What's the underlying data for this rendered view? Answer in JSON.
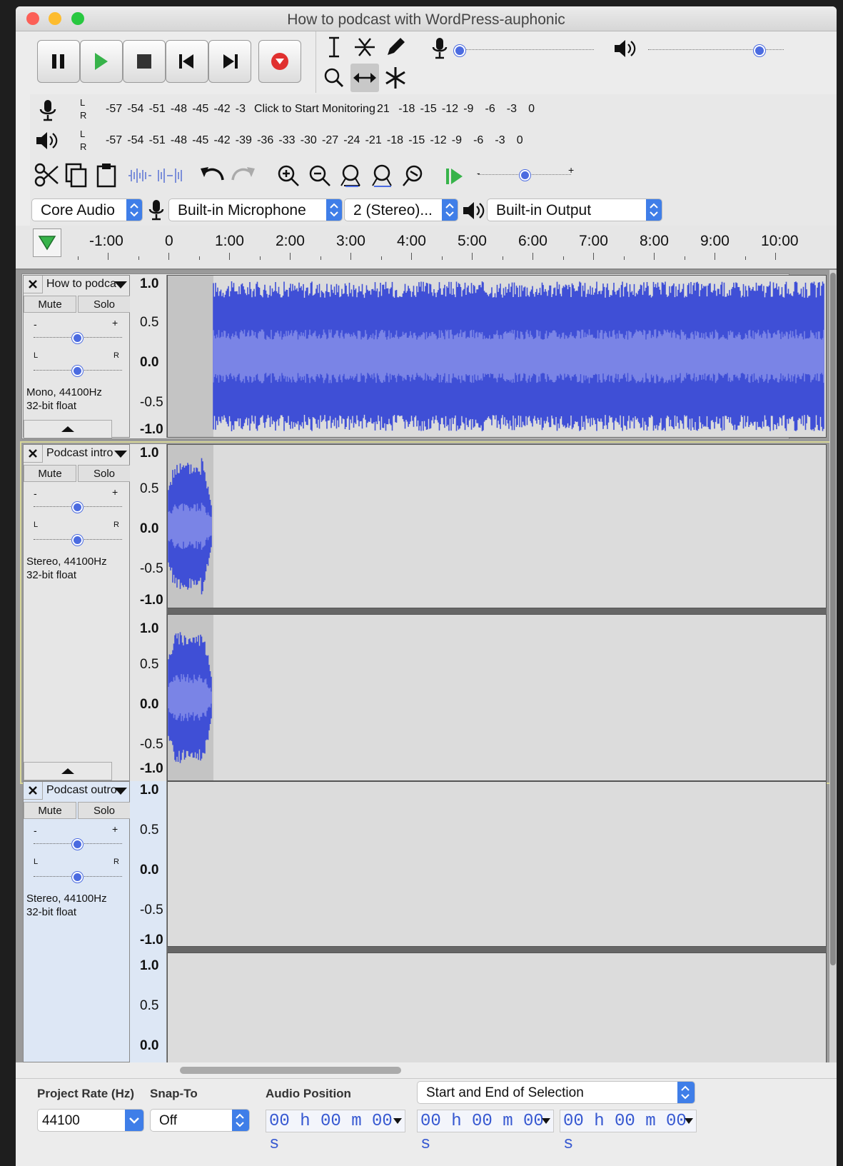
{
  "window": {
    "title": "How to podcast with WordPress-auphonic"
  },
  "meters": {
    "record_scale": [
      "-57",
      "-54",
      "-51",
      "-48",
      "-45",
      "-42",
      "-3"
    ],
    "record_hint": "Click to Start Monitoring",
    "record_scale_tail": [
      "21",
      "-18",
      "-15",
      "-12",
      "-9",
      "-6",
      "-3",
      "0"
    ],
    "play_scale": [
      "-57",
      "-54",
      "-51",
      "-48",
      "-45",
      "-42",
      "-39",
      "-36",
      "-33",
      "-30",
      "-27",
      "-24",
      "-21",
      "-18",
      "-15",
      "-12",
      "-9",
      "-6",
      "-3",
      "0"
    ],
    "channel_l": "L",
    "channel_r": "R"
  },
  "devices": {
    "host": "Core Audio",
    "input": "Built-in Microphone",
    "channels": "2 (Stereo)...",
    "output": "Built-in Output"
  },
  "timeline": {
    "labels": [
      "-1:00",
      "0",
      "1:00",
      "2:00",
      "3:00",
      "4:00",
      "5:00",
      "6:00",
      "7:00",
      "8:00",
      "9:00",
      "10:00"
    ]
  },
  "tracks": [
    {
      "name": "How to podca",
      "mute": "Mute",
      "solo": "Solo",
      "info1": "Mono, 44100Hz",
      "info2": "32-bit float",
      "gain_minus": "-",
      "gain_plus": "+",
      "pan_l": "L",
      "pan_r": "R"
    },
    {
      "name": "Podcast intro",
      "mute": "Mute",
      "solo": "Solo",
      "info1": "Stereo, 44100Hz",
      "info2": "32-bit float",
      "gain_minus": "-",
      "gain_plus": "+",
      "pan_l": "L",
      "pan_r": "R"
    },
    {
      "name": "Podcast outro",
      "mute": "Mute",
      "solo": "Solo",
      "info1": "Stereo, 44100Hz",
      "info2": "32-bit float",
      "gain_minus": "-",
      "gain_plus": "+",
      "pan_l": "L",
      "pan_r": "R"
    }
  ],
  "vruler": {
    "top": "1.0",
    "half": "0.5",
    "zero": "0.0",
    "nhalf": "-0.5",
    "bottom": "-1.0"
  },
  "selection_bar": {
    "project_rate_label": "Project Rate (Hz)",
    "project_rate_value": "44100",
    "snap_label": "Snap-To",
    "snap_value": "Off",
    "audio_pos_label": "Audio Position",
    "audio_pos_value": "00 h 00 m 00 s",
    "selection_mode": "Start and End of Selection",
    "sel_start": "00 h 00 m 00 s",
    "sel_end": "00 h 00 m 00 s"
  },
  "colors": {
    "waveform": "#3f4fd6",
    "waveform_rms": "#7a84e6",
    "accent": "#3f7ee8"
  }
}
